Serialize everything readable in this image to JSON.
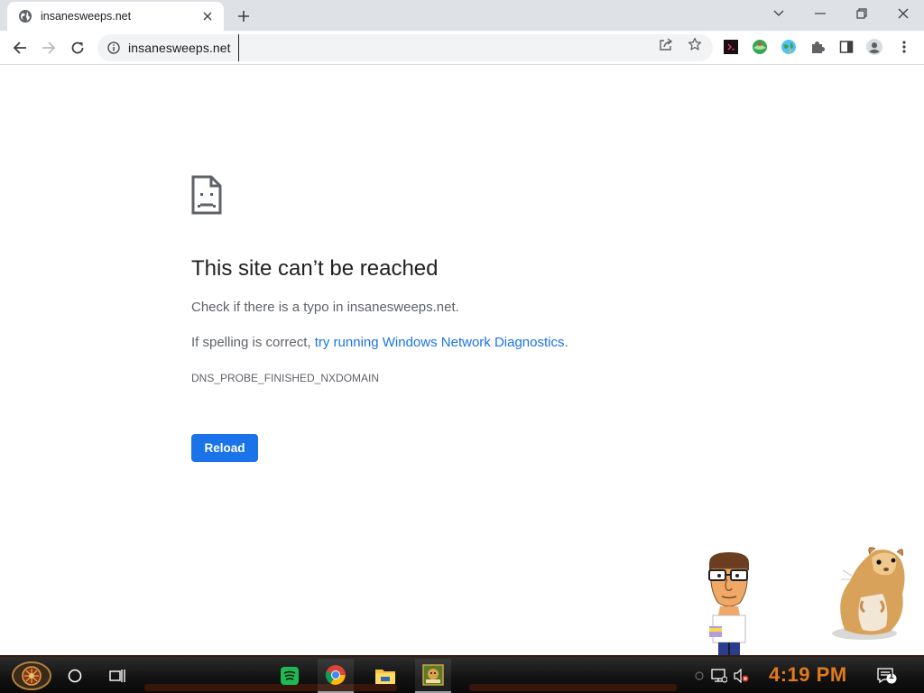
{
  "browser": {
    "tab": {
      "title": "insanesweeps.net"
    },
    "omnibox": {
      "url": "insanesweeps.net"
    }
  },
  "error_page": {
    "title": "This site can’t be reached",
    "line1": "Check if there is a typo in insanesweeps.net.",
    "line2_prefix": "If spelling is correct, ",
    "line2_link": "try running Windows Network Diagnostics",
    "line2_suffix": ".",
    "error_code": "DNS_PROBE_FINISHED_NXDOMAIN",
    "reload_label": "Reload"
  },
  "taskbar": {
    "clock": "4:19 PM",
    "notification_count": "1"
  },
  "colors": {
    "accent_blue": "#1a73e8",
    "clock_orange": "#e07a1a",
    "tabstrip_gray": "#dee1e6"
  }
}
